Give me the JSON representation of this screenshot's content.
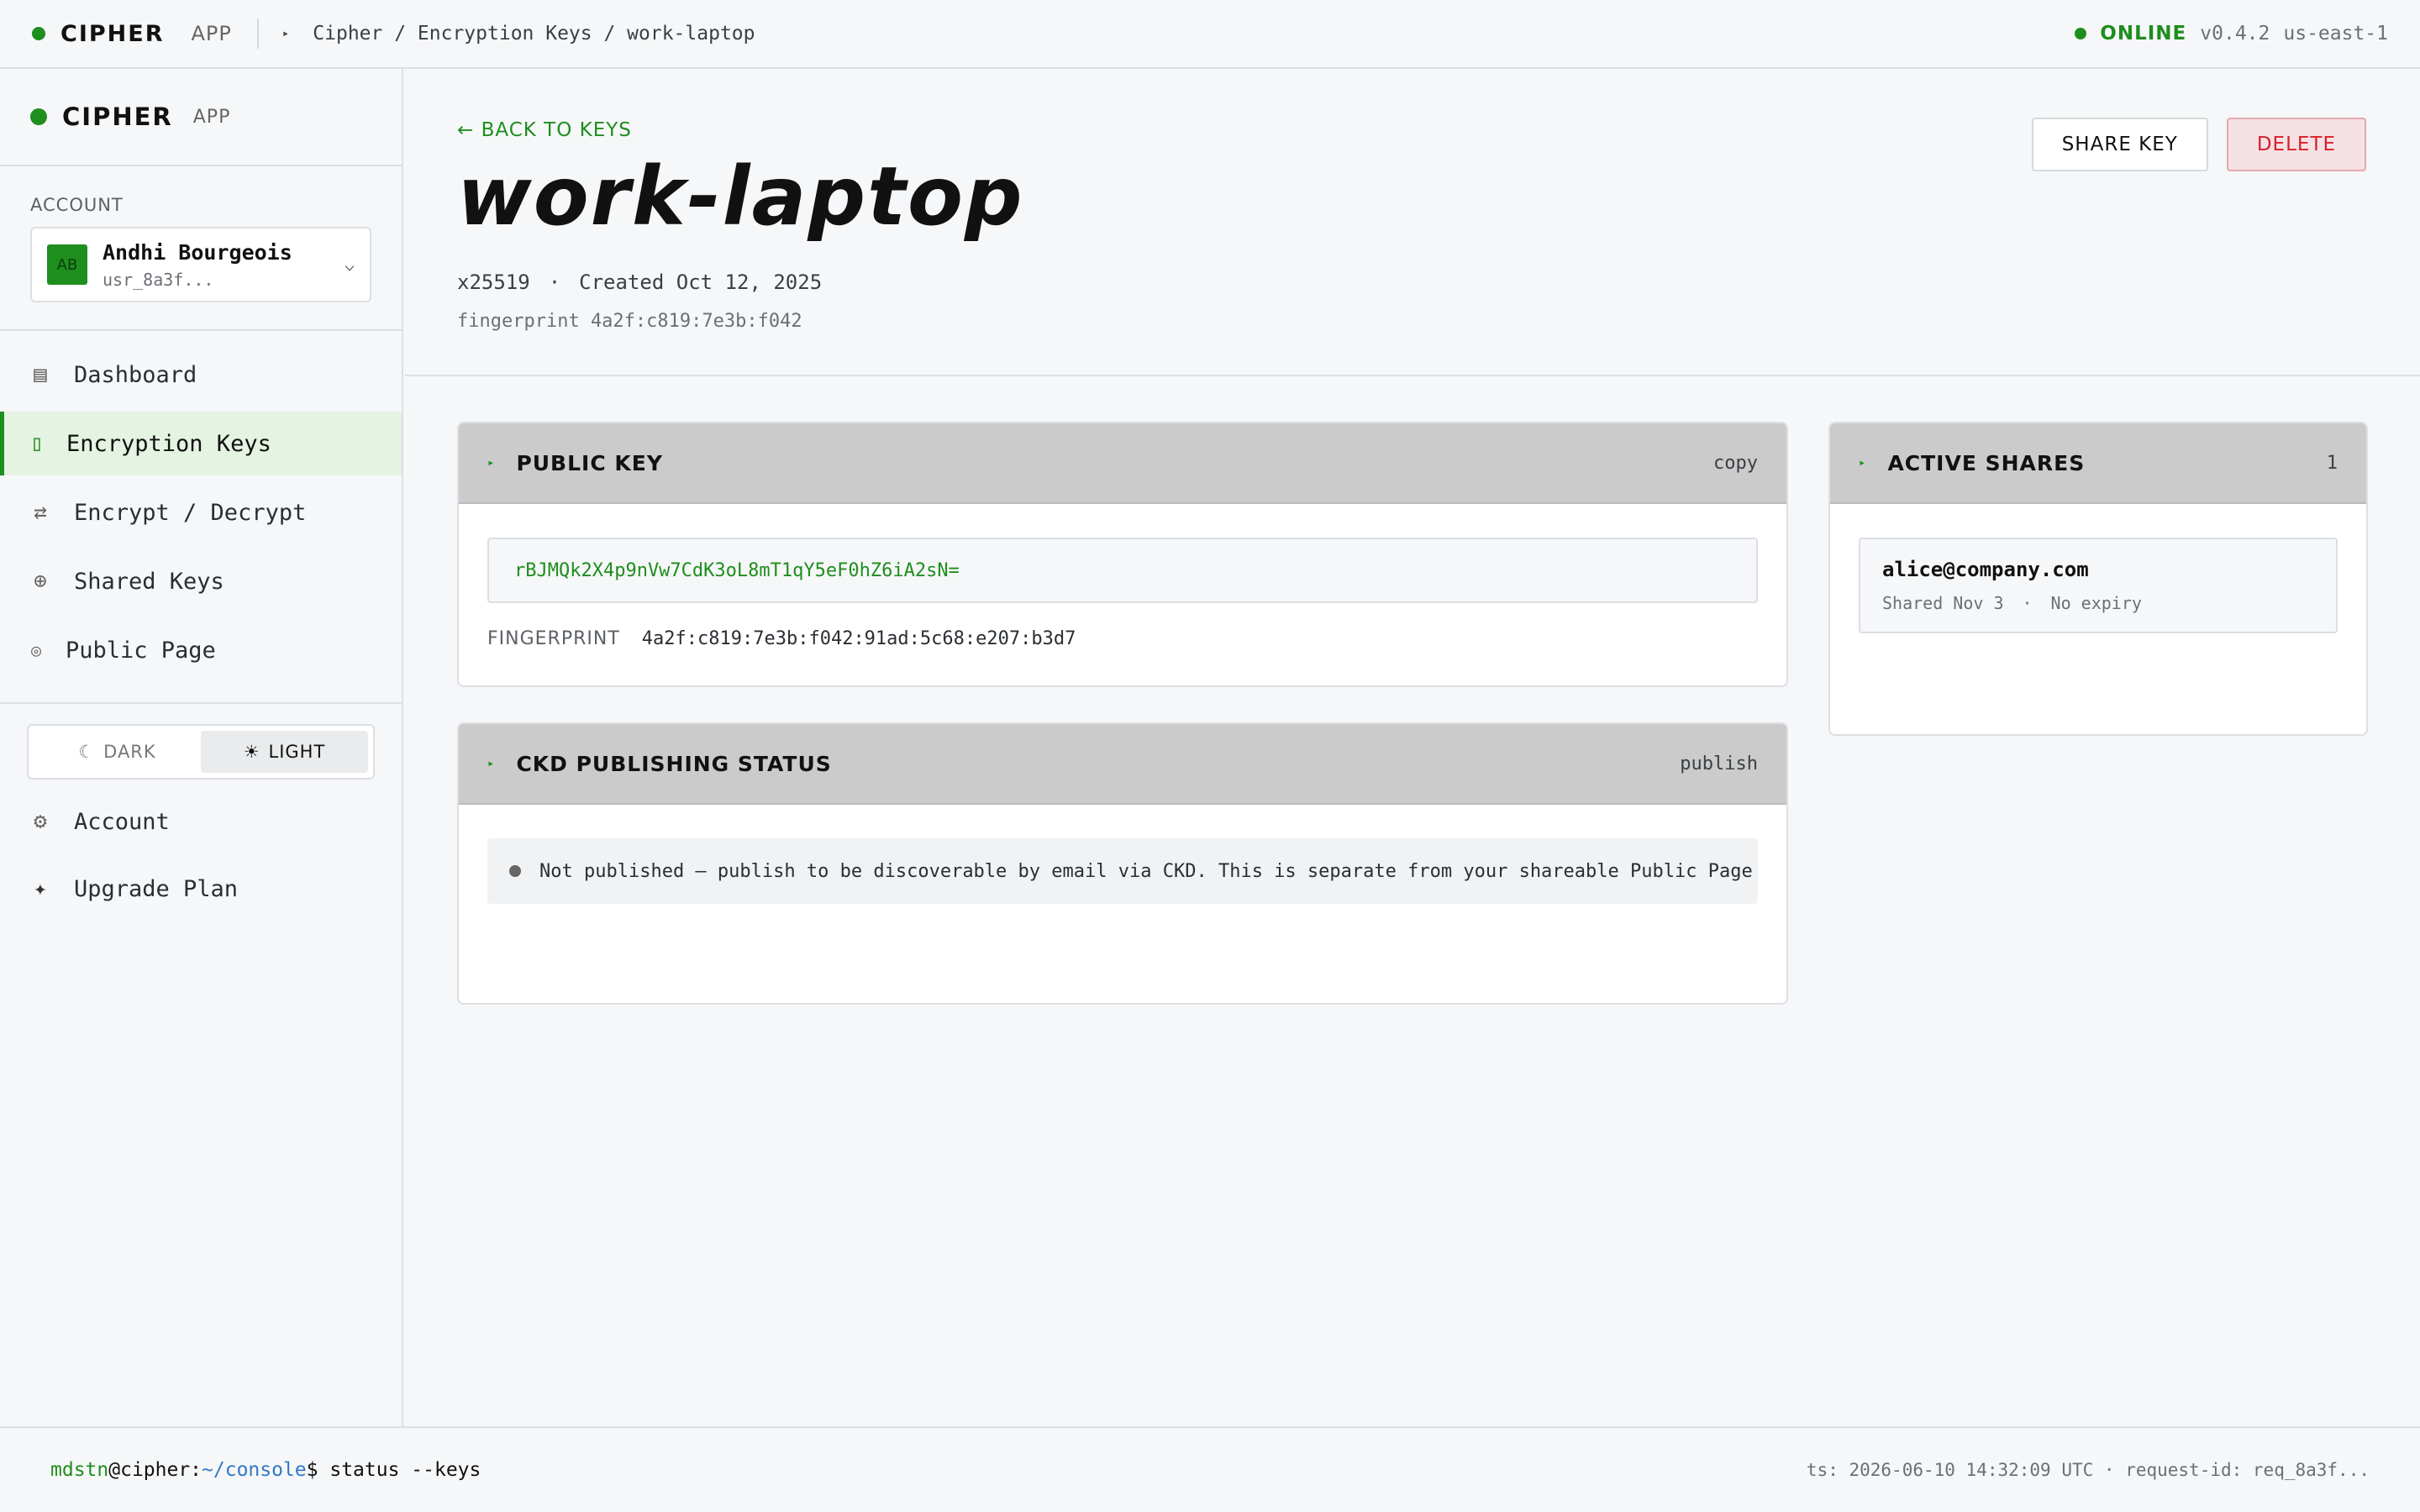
{
  "topbar": {
    "brand": "CIPHER",
    "brand_sub": "APP",
    "breadcrumb": "Cipher / Encryption Keys / work-laptop",
    "status": "ONLINE",
    "version": "v0.4.2",
    "region": "us-east-1"
  },
  "sidebar": {
    "brand": "CIPHER",
    "brand_sub": "APP",
    "account_label": "ACCOUNT",
    "account": {
      "initials": "AB",
      "name": "Andhi Bourgeois",
      "id": "usr_8a3f..."
    },
    "nav": [
      {
        "label": "Dashboard",
        "icon": "dashboard-icon"
      },
      {
        "label": "Encryption Keys",
        "icon": "key-icon",
        "active": true
      },
      {
        "label": "Encrypt / Decrypt",
        "icon": "swap-icon"
      },
      {
        "label": "Shared Keys",
        "icon": "share-icon"
      },
      {
        "label": "Public Page",
        "icon": "globe-icon"
      }
    ],
    "theme": {
      "dark": "DARK",
      "light": "LIGHT",
      "selected": "LIGHT"
    },
    "bottom_nav": [
      {
        "label": "Account",
        "icon": "gear-icon"
      },
      {
        "label": "Upgrade Plan",
        "icon": "sparkle-icon"
      }
    ]
  },
  "hero": {
    "back": "← BACK TO KEYS",
    "title": "work-laptop",
    "algorithm": "x25519",
    "separator": "·",
    "created": "Created Oct 12, 2025",
    "fingerprint_short": "fingerprint 4a2f:c819:7e3b:f042",
    "share_button": "SHARE KEY",
    "delete_button": "DELETE"
  },
  "public_key_panel": {
    "title": "PUBLIC KEY",
    "action": "copy",
    "key": "rBJMQk2X4p9nVw7CdK3oL8mT1qY5eF0hZ6iA2sN=",
    "fingerprint_label": "FINGERPRINT",
    "fingerprint": "4a2f:c819:7e3b:f042:91ad:5c68:e207:b3d7"
  },
  "ckd_panel": {
    "title": "CKD PUBLISHING STATUS",
    "action": "publish",
    "status": "Not published — publish to be discoverable by email via CKD. This is separate from your shareable Public Page link."
  },
  "shares_panel": {
    "title": "ACTIVE SHARES",
    "count": "1",
    "items": [
      {
        "email": "alice@company.com",
        "shared": "Shared Nov 3",
        "separator": "·",
        "expiry": "No expiry"
      }
    ]
  },
  "terminal": {
    "user": "mdstn",
    "host": "@cipher:",
    "path": "~/console",
    "prompt": "$ ",
    "command": "status --keys",
    "info": "ts: 2026-06-10 14:32:09 UTC · request-id: req_8a3f..."
  },
  "colors": {
    "accent": "#1e8e1e",
    "danger": "#d81f2b",
    "panel_header": "#cbcbcb"
  }
}
